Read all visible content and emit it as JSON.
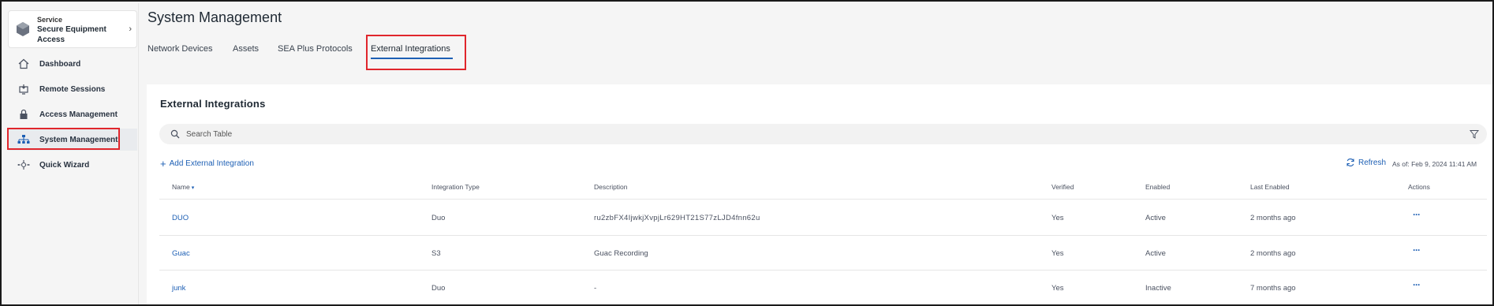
{
  "sidebar": {
    "service": {
      "eyebrow": "Service",
      "name": "Secure Equipment Access",
      "chevron": "›"
    },
    "items": [
      {
        "label": "Dashboard",
        "icon": "home-icon"
      },
      {
        "label": "Remote Sessions",
        "icon": "remote-sessions-icon"
      },
      {
        "label": "Access Management",
        "icon": "lock-icon"
      },
      {
        "label": "System Management",
        "icon": "system-management-icon",
        "active": true
      },
      {
        "label": "Quick Wizard",
        "icon": "wizard-icon"
      }
    ]
  },
  "header": {
    "title": "System Management",
    "tabs": [
      {
        "label": "Network Devices"
      },
      {
        "label": "Assets"
      },
      {
        "label": "SEA Plus Protocols"
      },
      {
        "label": "External Integrations",
        "active": true
      }
    ]
  },
  "panel": {
    "title": "External Integrations",
    "search": {
      "placeholder": "Search Table",
      "value": ""
    },
    "add_label": "Add External Integration",
    "refresh_label": "Refresh",
    "as_of": "As of: Feb 9, 2024 11:41 AM"
  },
  "table": {
    "columns": [
      "Name",
      "Integration Type",
      "Description",
      "Verified",
      "Enabled",
      "Last Enabled",
      "Actions"
    ],
    "sort_indicator": "▾",
    "rows": [
      {
        "name": "DUO",
        "type": "Duo",
        "description": "ru2zbFX4IjwkjXvpjLr629HT21S77zLJD4fnn62u",
        "verified": "Yes",
        "enabled": "Active",
        "last_enabled": "2 months ago",
        "actions": "···"
      },
      {
        "name": "Guac",
        "type": "S3",
        "description": "Guac Recording",
        "verified": "Yes",
        "enabled": "Active",
        "last_enabled": "2 months ago",
        "actions": "···"
      },
      {
        "name": "junk",
        "type": "Duo",
        "description": "-",
        "verified": "Yes",
        "enabled": "Inactive",
        "last_enabled": "7 months ago",
        "actions": "···"
      }
    ]
  },
  "colors": {
    "accent": "#1d5fb4",
    "highlight": "#e0262c",
    "page_bg": "#f5f5f5",
    "panel_bg": "#ffffff"
  }
}
